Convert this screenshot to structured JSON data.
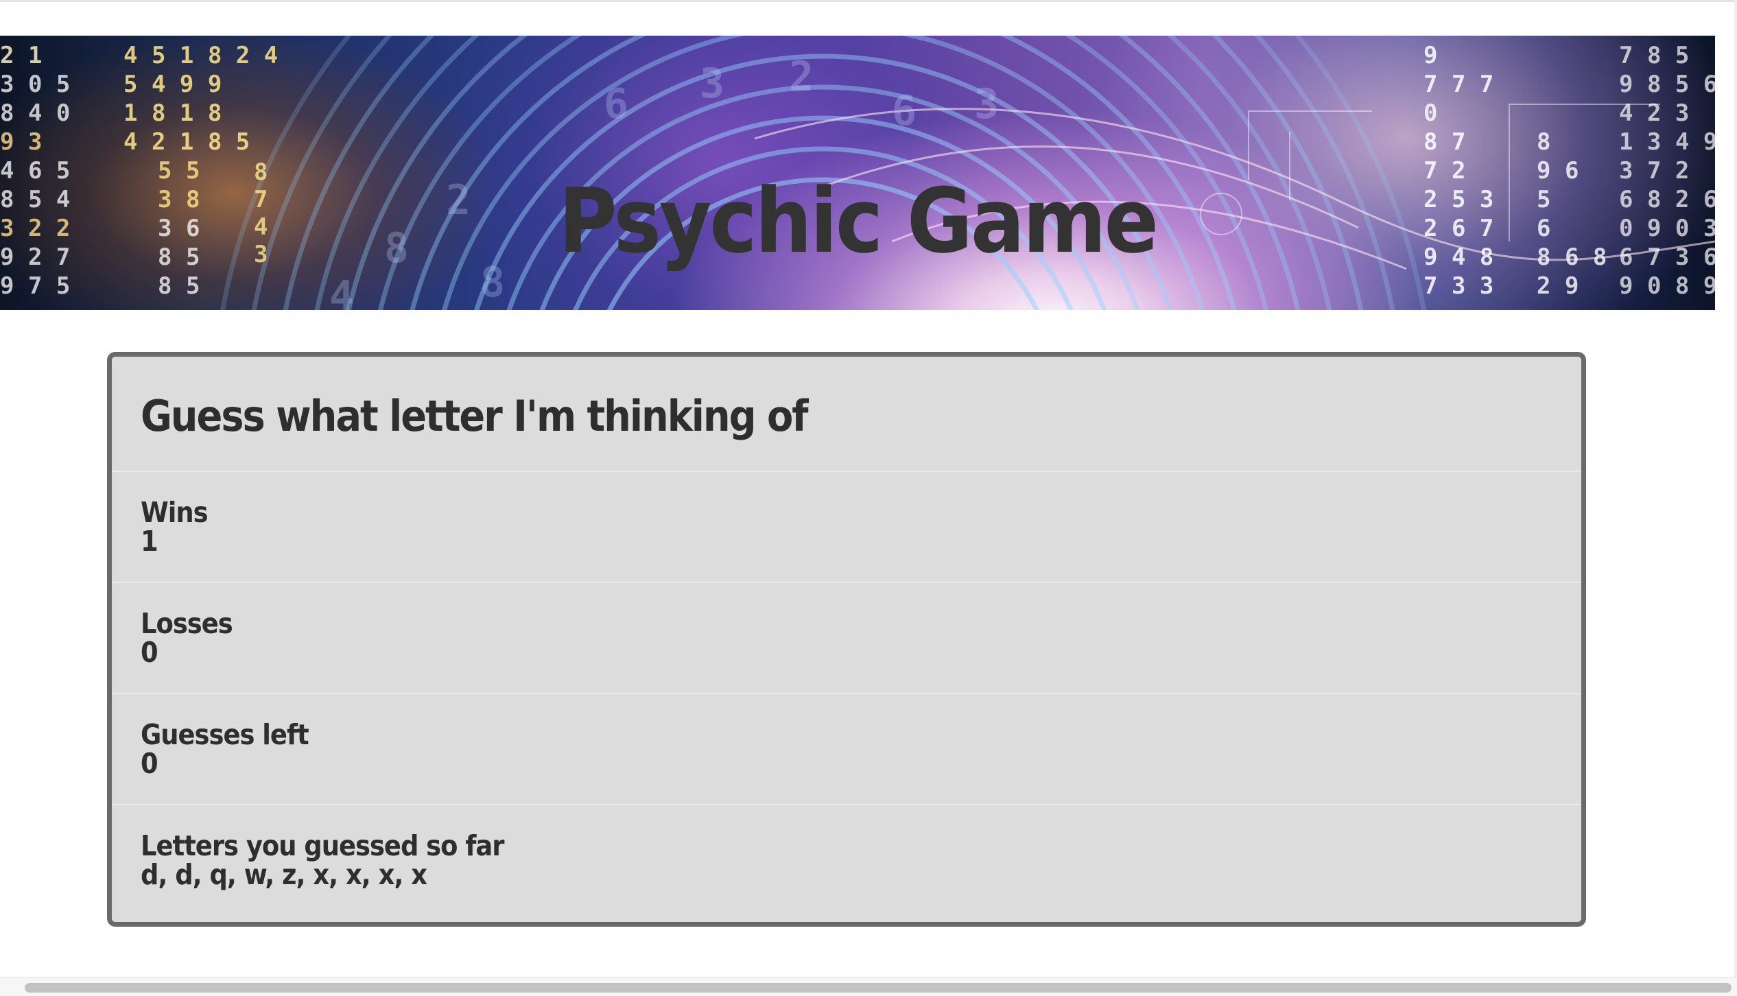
{
  "header": {
    "title": "Psychic Game"
  },
  "game": {
    "heading": "Guess what letter I'm thinking of",
    "wins": {
      "label": "Wins",
      "value": "1"
    },
    "losses": {
      "label": "Losses",
      "value": "0"
    },
    "guesses_left": {
      "label": "Guesses left",
      "value": "0"
    },
    "letters_guessed": {
      "label": "Letters you guessed so far",
      "value": "d, d, q, w, z, x, x, x, x"
    }
  },
  "colors": {
    "title_text": "#333333",
    "panel_background": "#dcdcdc",
    "panel_border": "#6a6a6a"
  }
}
